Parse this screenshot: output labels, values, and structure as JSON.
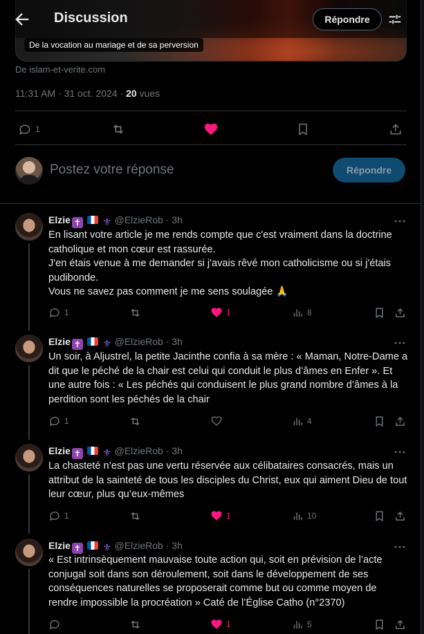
{
  "header": {
    "title": "Discussion",
    "reply_button": "Répondre"
  },
  "card": {
    "caption": "De la vocation au mariage et de sa perversion",
    "source": "De islam-et-verite.com"
  },
  "post_meta": {
    "time": "11:31 AM",
    "date": "31 oct. 2024",
    "views_count": "20",
    "views_label": "vues"
  },
  "post_actions": {
    "replies": "1",
    "liked": true
  },
  "compose": {
    "placeholder": "Postez votre réponse",
    "button": "Répondre"
  },
  "replies": [
    {
      "name": "Elzie",
      "handle": "@ElzieRob",
      "time": "3h",
      "lines": [
        "En lisant votre article je me rends compte que c'est vraiment dans la doctrine catholique et mon cœur est rassurée.",
        "J'en étais venue à me demander si j'avais rêvé mon catholicisme ou si j'étais pudibonde.",
        "Vous ne savez pas comment je me sens soulagée 🙏"
      ],
      "replies": "1",
      "likes": "1",
      "liked": true,
      "views": "8"
    },
    {
      "name": "Elzie",
      "handle": "@ElzieRob",
      "time": "3h",
      "lines": [
        "Un soir, à Aljustrel, la petite Jacinthe confia à sa mère : « Maman, Notre-Dame a dit que le péché de la chair est celui qui conduit le plus d’âmes en Enfer ». Et une autre fois : « Les péchés qui conduisent le plus grand nombre d’âmes à la perdition sont les péchés de la chair"
      ],
      "replies": "1",
      "likes": "",
      "liked": false,
      "views": "4"
    },
    {
      "name": "Elzie",
      "handle": "@ElzieRob",
      "time": "3h",
      "lines": [
        "La chasteté n’est pas une vertu réservée aux célibataires consacrés, mais un attribut de la sainteté de tous les disciples du Christ, eux qui aiment Dieu de tout leur cœur, plus qu’eux-mêmes"
      ],
      "replies": "1",
      "likes": "1",
      "liked": true,
      "views": "10"
    },
    {
      "name": "Elzie",
      "handle": "@ElzieRob",
      "time": "3h",
      "lines": [
        "« Est intrinsèquement mauvaise toute action qui, soit en prévision de l’acte conjugal soit dans son déroulement, soit dans le développement de ses conséquences naturelles se proposerait comme but ou comme moyen de rendre impossible la procréation » Caté de l’Église Catho (n°2370)"
      ],
      "replies": "",
      "likes": "1",
      "liked": true,
      "views": "5"
    }
  ],
  "colors": {
    "background": "#000000",
    "text": "#e7e9ea",
    "muted": "#71767b",
    "like": "#f91880",
    "accent_disabled": "#0f4a70"
  }
}
